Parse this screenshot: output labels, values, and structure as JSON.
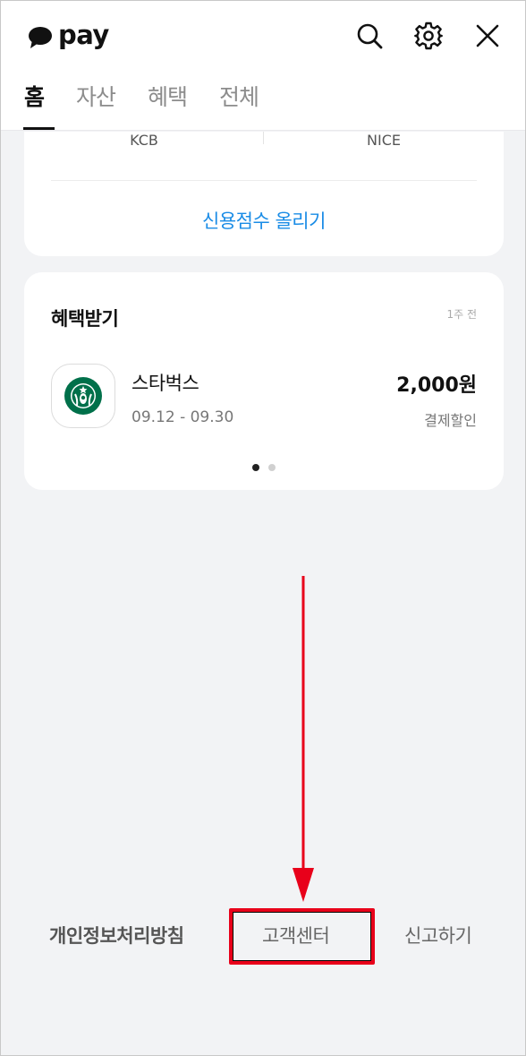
{
  "header": {
    "logo_text": "pay",
    "icons": [
      "search-icon",
      "gear-icon",
      "close-icon"
    ],
    "tabs": [
      {
        "label": "홈",
        "active": true
      },
      {
        "label": "자산",
        "active": false
      },
      {
        "label": "혜택",
        "active": false
      },
      {
        "label": "전체",
        "active": false
      }
    ]
  },
  "credit": {
    "bureaus": [
      "KCB",
      "NICE"
    ],
    "raise_link": "신용점수 올리기"
  },
  "benefit": {
    "title": "혜택받기",
    "time": "1주 전",
    "item": {
      "name": "스타벅스",
      "period": "09.12 - 09.30",
      "amount": "2,000원",
      "type": "결제할인",
      "logo_icon": "starbucks-logo"
    },
    "page_dots": {
      "count": 2,
      "active": 1
    }
  },
  "footer": {
    "privacy": "개인정보처리방침",
    "customer_center": "고객센터",
    "report": "신고하기"
  },
  "colors": {
    "accent_link": "#1a8ce6",
    "highlight": "#e8001a",
    "background": "#f2f3f5"
  }
}
